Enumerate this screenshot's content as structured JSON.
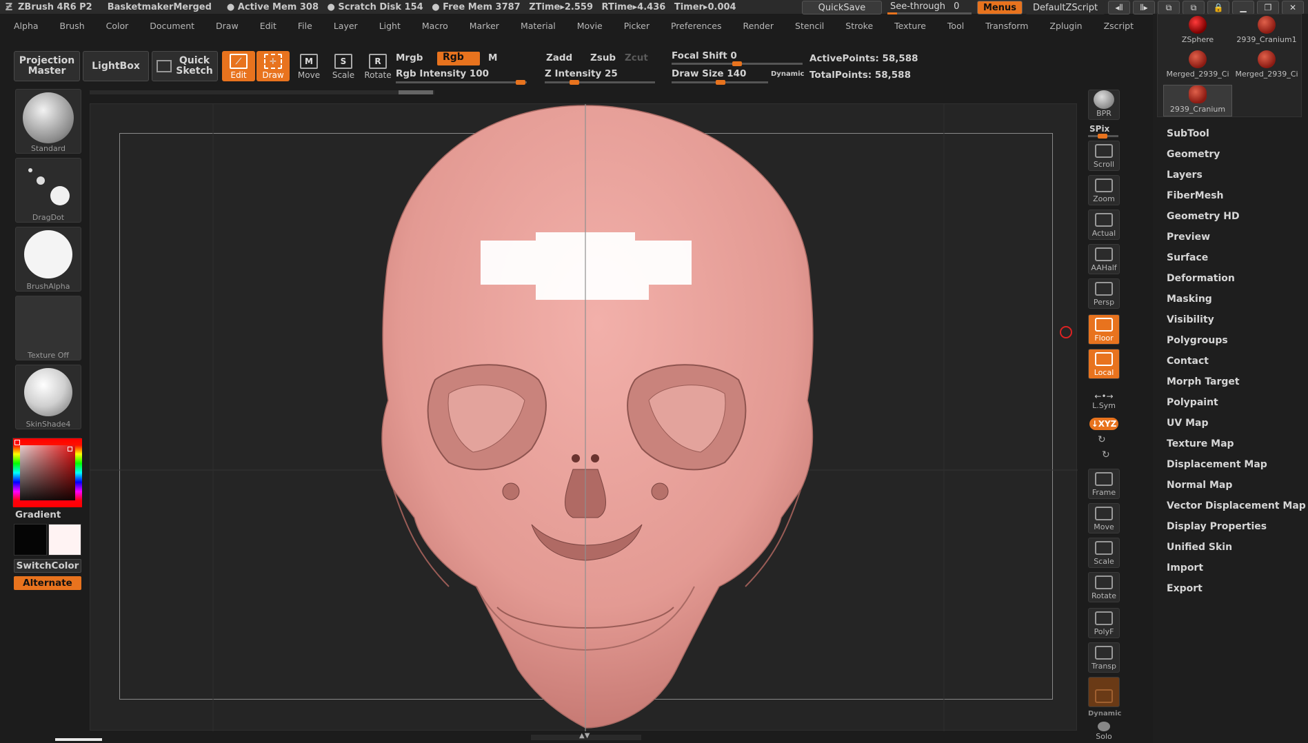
{
  "titlebar": {
    "app": "ZBrush 4R6 P2",
    "document": "BasketmakerMerged",
    "active_mem": "Active Mem 308",
    "scratch_disk": "Scratch Disk 154",
    "free_mem": "Free Mem 3787",
    "ztime": "ZTime▸2.559",
    "rtime": "RTime▸4.436",
    "timer": "Timer▸0.004",
    "quicksave": "QuickSave",
    "see_through": "See-through",
    "see_through_value": "0",
    "menus": "Menus",
    "default_zscript": "DefaultZScript"
  },
  "menubar": [
    "Alpha",
    "Brush",
    "Color",
    "Document",
    "Draw",
    "Edit",
    "File",
    "Layer",
    "Light",
    "Macro",
    "Marker",
    "Material",
    "Movie",
    "Picker",
    "Preferences",
    "Render",
    "Stencil",
    "Stroke",
    "Texture",
    "Tool",
    "Transform",
    "Zplugin",
    "Zscript"
  ],
  "toolbar": {
    "projection_master_1": "Projection",
    "projection_master_2": "Master",
    "lightbox": "LightBox",
    "quick_sketch_1": "Quick",
    "quick_sketch_2": "Sketch",
    "edit": "Edit",
    "draw": "Draw",
    "move": "Move",
    "scale": "Scale",
    "rotate": "Rotate",
    "mrgb": "Mrgb",
    "rgb": "Rgb",
    "m": "M",
    "zadd": "Zadd",
    "zsub": "Zsub",
    "zcut": "Zcut",
    "rgb_intensity": "Rgb Intensity 100",
    "z_intensity": "Z Intensity 25",
    "focal_shift": "Focal Shift 0",
    "draw_size": "Draw Size 140",
    "dynamic": "Dynamic",
    "active_points": "ActivePoints: 58,588",
    "total_points": "TotalPoints: 58,588",
    "rgb_intensity_value": 100,
    "z_intensity_value": 25
  },
  "leftshelf": {
    "brush": "Standard",
    "stroke": "DragDot",
    "alpha": "BrushAlpha",
    "texture": "Texture  Off",
    "material": "SkinShade4",
    "gradient": "Gradient",
    "switchcolor": "SwitchColor",
    "alternate": "Alternate"
  },
  "rightshelf": {
    "bpr": "BPR",
    "spix": "SPix",
    "scroll": "Scroll",
    "zoom": "Zoom",
    "actual": "Actual",
    "aahalf": "AAHalf",
    "persp": "Persp",
    "floor": "Floor",
    "local": "Local",
    "lsym": "L.Sym",
    "xyz": "↓XYZ",
    "frame": "Frame",
    "move": "Move",
    "scale": "Scale",
    "rotate": "Rotate",
    "polyf": "PolyF",
    "transp": "Transp",
    "dynamic": "Dynamic",
    "solo": "Solo"
  },
  "subtools": [
    {
      "name": "ZSphere"
    },
    {
      "name": "2939_Cranium1"
    },
    {
      "name": "Merged_2939_Ci"
    },
    {
      "name": "Merged_2939_Ci"
    },
    {
      "name": "2939_Cranium"
    }
  ],
  "palette": [
    "SubTool",
    "Geometry",
    "Layers",
    "FiberMesh",
    "Geometry HD",
    "Preview",
    "Surface",
    "Deformation",
    "Masking",
    "Visibility",
    "Polygroups",
    "Contact",
    "Morph Target",
    "Polypaint",
    "UV Map",
    "Texture Map",
    "Displacement Map",
    "Normal Map",
    "Vector Displacement Map",
    "Display Properties",
    "Unified Skin",
    "Import",
    "Export"
  ],
  "colors": {
    "accent": "#e8731e",
    "skull": "#e9a29c",
    "background": "#1c1c1c"
  }
}
